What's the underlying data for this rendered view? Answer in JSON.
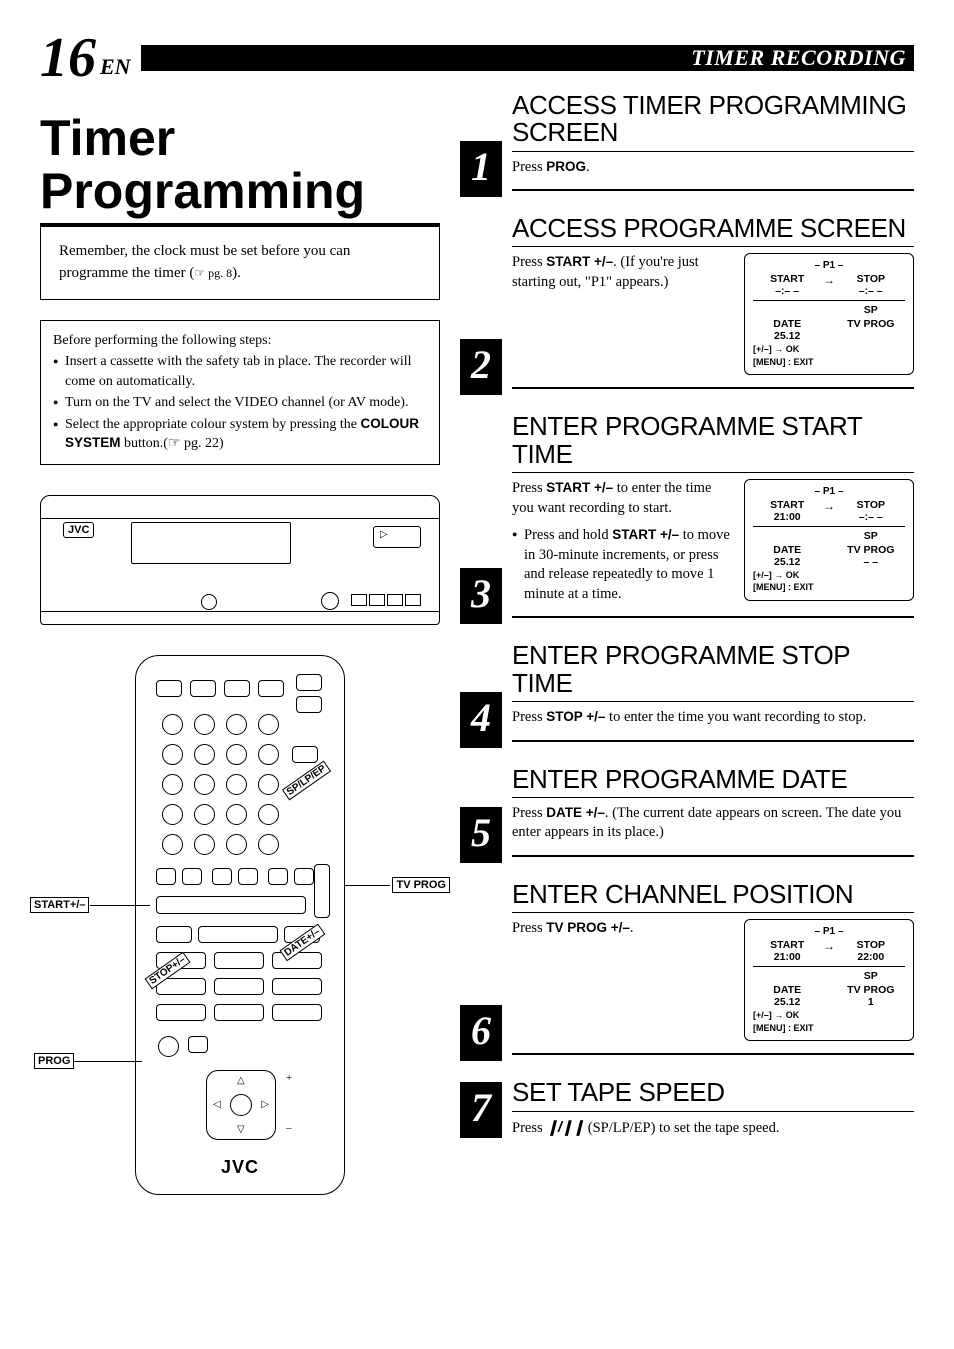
{
  "header": {
    "page_number": "16",
    "language": "EN",
    "section_title": "TIMER RECORDING"
  },
  "main_title": "Timer Programming",
  "reminder_note": {
    "text_before": "Remember, the clock must be set before you can programme the timer (",
    "ref": "☞ pg. 8",
    "text_after": ")."
  },
  "prep": {
    "intro": "Before performing the following steps:",
    "items": [
      "Insert a cassette with the safety tab in place. The recorder will come on automatically.",
      "Turn on the TV and select the VIDEO channel (or AV mode).",
      "Select the appropriate colour system by pressing the "
    ],
    "item3_bold": "COLOUR SYSTEM",
    "item3_tail": " button.(☞ pg. 22)"
  },
  "vcr": {
    "brand": "JVC"
  },
  "remote": {
    "brand": "JVC",
    "labels": {
      "start": "START+/–",
      "stop": "STOP+/–",
      "date": "DATE+/–",
      "tvprog": "TV PROG",
      "prog": "PROG",
      "speed": "SP/LP/EP"
    }
  },
  "steps": [
    {
      "num": "1",
      "title": "ACCESS TIMER PROGRAMMING SCREEN",
      "body_pre": "Press ",
      "body_bold": "PROG",
      "body_post": "."
    },
    {
      "num": "2",
      "title": "ACCESS PROGRAMME SCREEN",
      "body_pre": "Press ",
      "body_bold": "START +/–",
      "body_post": ". (If you're just starting out, \"P1\" appears.)",
      "osd": {
        "p": "– P1 –",
        "start_label": "START",
        "start_val": "–:– –",
        "stop_label": "STOP",
        "stop_val": "–:– –",
        "speed": "SP",
        "date_label": "DATE",
        "date_val": "25.12",
        "tvprog_label": "TV PROG",
        "tvprog_val": "",
        "foot1": "[+/–] → OK",
        "foot2": "[MENU] : EXIT"
      }
    },
    {
      "num": "3",
      "title": "ENTER PROGRAMME START TIME",
      "body_pre": "Press ",
      "body_bold": "START +/–",
      "body_post": " to enter the time you want recording to start.",
      "note_pre": "Press and hold ",
      "note_bold": "START +/–",
      "note_post": " to move in 30-minute increments, or press and release repeatedly to move 1 minute at a time.",
      "osd": {
        "p": "– P1 –",
        "start_label": "START",
        "start_val": "21:00",
        "stop_label": "STOP",
        "stop_val": "–:– –",
        "speed": "SP",
        "date_label": "DATE",
        "date_val": "25.12",
        "tvprog_label": "TV PROG",
        "tvprog_val": "– –",
        "foot1": "[+/–] → OK",
        "foot2": "[MENU] : EXIT"
      }
    },
    {
      "num": "4",
      "title": "ENTER PROGRAMME STOP TIME",
      "body_pre": "Press ",
      "body_bold": "STOP +/–",
      "body_post": " to enter the time you want recording to stop."
    },
    {
      "num": "5",
      "title": "ENTER PROGRAMME DATE",
      "body_pre": "Press ",
      "body_bold": "DATE +/–",
      "body_post": ". (The current date appears on screen. The date you enter appears in its place.)"
    },
    {
      "num": "6",
      "title": "ENTER CHANNEL POSITION",
      "body_pre": "Press ",
      "body_bold": "TV PROG +/–",
      "body_post": ".",
      "osd": {
        "p": "– P1 –",
        "start_label": "START",
        "start_val": "21:00",
        "stop_label": "STOP",
        "stop_val": "22:00",
        "speed": "SP",
        "date_label": "DATE",
        "date_val": "25.12",
        "tvprog_label": "TV PROG",
        "tvprog_val": "1",
        "foot1": "[+/–] → OK",
        "foot2": "[MENU] : EXIT"
      }
    },
    {
      "num": "7",
      "title": "SET TAPE SPEED",
      "body_pre": "Press  ",
      "body_icon": "❙/❙❙",
      "body_post": "  (SP/LP/EP) to set the tape speed."
    }
  ]
}
